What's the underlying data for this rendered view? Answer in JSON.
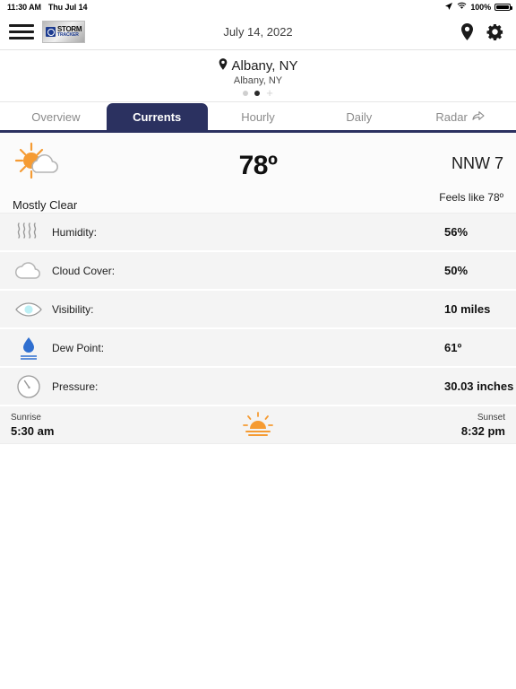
{
  "statusbar": {
    "time": "11:30 AM",
    "date": "Thu Jul 14",
    "battery_pct": "100%",
    "icons": [
      "location-arrow-icon",
      "wifi-icon",
      "battery-icon"
    ]
  },
  "navbar": {
    "menu_icon": "hamburger-menu-icon",
    "logo_title": "STORM",
    "logo_subtitle": "TRACKER",
    "date": "July 14, 2022",
    "location_icon": "map-pin-icon",
    "settings_icon": "gear-icon"
  },
  "location": {
    "name": "Albany, NY",
    "sub": "Albany, NY",
    "pin_icon": "map-pin-icon",
    "pages": 2,
    "active_page": 2,
    "add_label": "+"
  },
  "tabs": [
    {
      "label": "Overview",
      "active": false
    },
    {
      "label": "Currents",
      "active": true
    },
    {
      "label": "Hourly",
      "active": false
    },
    {
      "label": "Daily",
      "active": false
    },
    {
      "label": "Radar",
      "active": false,
      "icon": "share-arrow-icon"
    }
  ],
  "current": {
    "icon": "sun-behind-cloud-icon",
    "condition": "Mostly Clear",
    "temperature": "78º",
    "wind": "NNW 7",
    "feels_like": "Feels like 78º"
  },
  "details": [
    {
      "icon": "humidity-waves-icon",
      "label": "Humidity:",
      "value": "56%"
    },
    {
      "icon": "cloud-icon",
      "label": "Cloud Cover:",
      "value": "50%"
    },
    {
      "icon": "eye-visibility-icon",
      "label": "Visibility:",
      "value": "10 miles"
    },
    {
      "icon": "water-droplet-icon",
      "label": "Dew Point:",
      "value": "61º"
    },
    {
      "icon": "barometer-gauge-icon",
      "label": "Pressure:",
      "value": "30.03 inches"
    }
  ],
  "sun": {
    "sunrise_label": "Sunrise",
    "sunrise_time": "5:30 am",
    "sunset_label": "Sunset",
    "sunset_time": "8:32 pm",
    "icon": "sunrise-icon"
  },
  "colors": {
    "accent_navy": "#2b3160",
    "sun_orange": "#f59b33",
    "row_bg": "#f4f4f4",
    "droplet_blue": "#2f6fd0"
  }
}
